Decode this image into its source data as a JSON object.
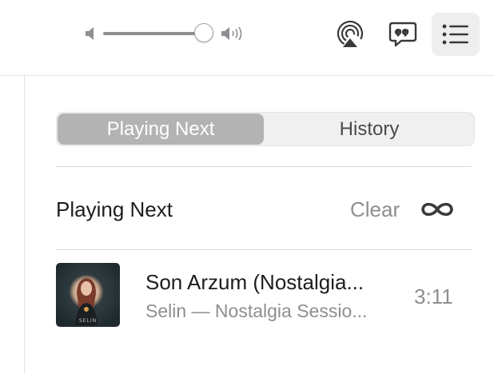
{
  "toolbar": {
    "volume": {
      "level": 0.97,
      "low_icon": "speaker-low-icon",
      "high_icon": "speaker-high-icon"
    },
    "buttons": [
      {
        "name": "airplay-button",
        "icon": "airplay-icon",
        "active": false
      },
      {
        "name": "lyrics-button",
        "icon": "quote-bubble-icon",
        "active": false
      },
      {
        "name": "queue-button",
        "icon": "list-icon",
        "active": true
      }
    ]
  },
  "queue": {
    "tabs": [
      {
        "label": "Playing Next",
        "selected": true
      },
      {
        "label": "History",
        "selected": false
      }
    ],
    "section_title": "Playing Next",
    "clear_label": "Clear",
    "autoplay_icon": "infinity-icon",
    "items": [
      {
        "title": "Son Arzum (Nostalgia...",
        "subtitle": "Selin — Nostalgia Sessio...",
        "duration": "3:11",
        "artwork_text": "SELIN"
      }
    ]
  },
  "colors": {
    "accent_selected": "#b3b3b3",
    "secondary_text": "#8e8e93",
    "divider": "#d9d9d9"
  }
}
